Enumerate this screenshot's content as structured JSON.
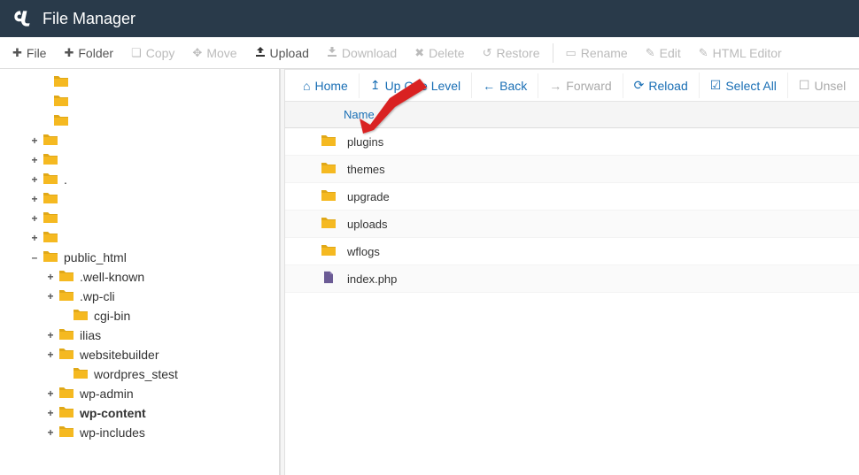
{
  "header": {
    "title": "File Manager"
  },
  "toolbar": {
    "file": "File",
    "folder": "Folder",
    "copy": "Copy",
    "move": "Move",
    "upload": "Upload",
    "download": "Download",
    "delete": "Delete",
    "restore": "Restore",
    "rename": "Rename",
    "edit": "Edit",
    "html_editor": "HTML Editor"
  },
  "nav": {
    "home": "Home",
    "up": "Up One Level",
    "back": "Back",
    "forward": "Forward",
    "reload": "Reload",
    "select_all": "Select All",
    "unselect": "Unsel"
  },
  "columns": {
    "name": "Name"
  },
  "tree": {
    "top": [
      {
        "toggle": "",
        "indent": 34
      },
      {
        "toggle": "",
        "indent": 34
      },
      {
        "toggle": "",
        "indent": 34
      },
      {
        "toggle": "+",
        "indent": 22
      },
      {
        "toggle": "+",
        "indent": 22
      },
      {
        "toggle": "+",
        "indent": 22,
        "label": "."
      },
      {
        "toggle": "+",
        "indent": 22
      },
      {
        "toggle": "+",
        "indent": 22
      },
      {
        "toggle": "+",
        "indent": 22
      }
    ],
    "public_html": {
      "label": "public_html",
      "toggle": "–",
      "indent": 22
    },
    "children": [
      {
        "label": ".well-known",
        "toggle": "+",
        "indent": 40
      },
      {
        "label": ".wp-cli",
        "toggle": "+",
        "indent": 40
      },
      {
        "label": "cgi-bin",
        "toggle": "",
        "indent": 56
      },
      {
        "label": "ilias",
        "toggle": "+",
        "indent": 40
      },
      {
        "label": "websitebuilder",
        "toggle": "+",
        "indent": 40
      },
      {
        "label": "wordpres_stest",
        "toggle": "",
        "indent": 56
      },
      {
        "label": "wp-admin",
        "toggle": "+",
        "indent": 40
      },
      {
        "label": "wp-content",
        "toggle": "+",
        "indent": 40,
        "selected": true
      },
      {
        "label": "wp-includes",
        "toggle": "+",
        "indent": 40
      }
    ]
  },
  "files": [
    {
      "name": "plugins",
      "type": "folder"
    },
    {
      "name": "themes",
      "type": "folder"
    },
    {
      "name": "upgrade",
      "type": "folder"
    },
    {
      "name": "uploads",
      "type": "folder"
    },
    {
      "name": "wflogs",
      "type": "folder"
    },
    {
      "name": "index.php",
      "type": "php"
    }
  ]
}
